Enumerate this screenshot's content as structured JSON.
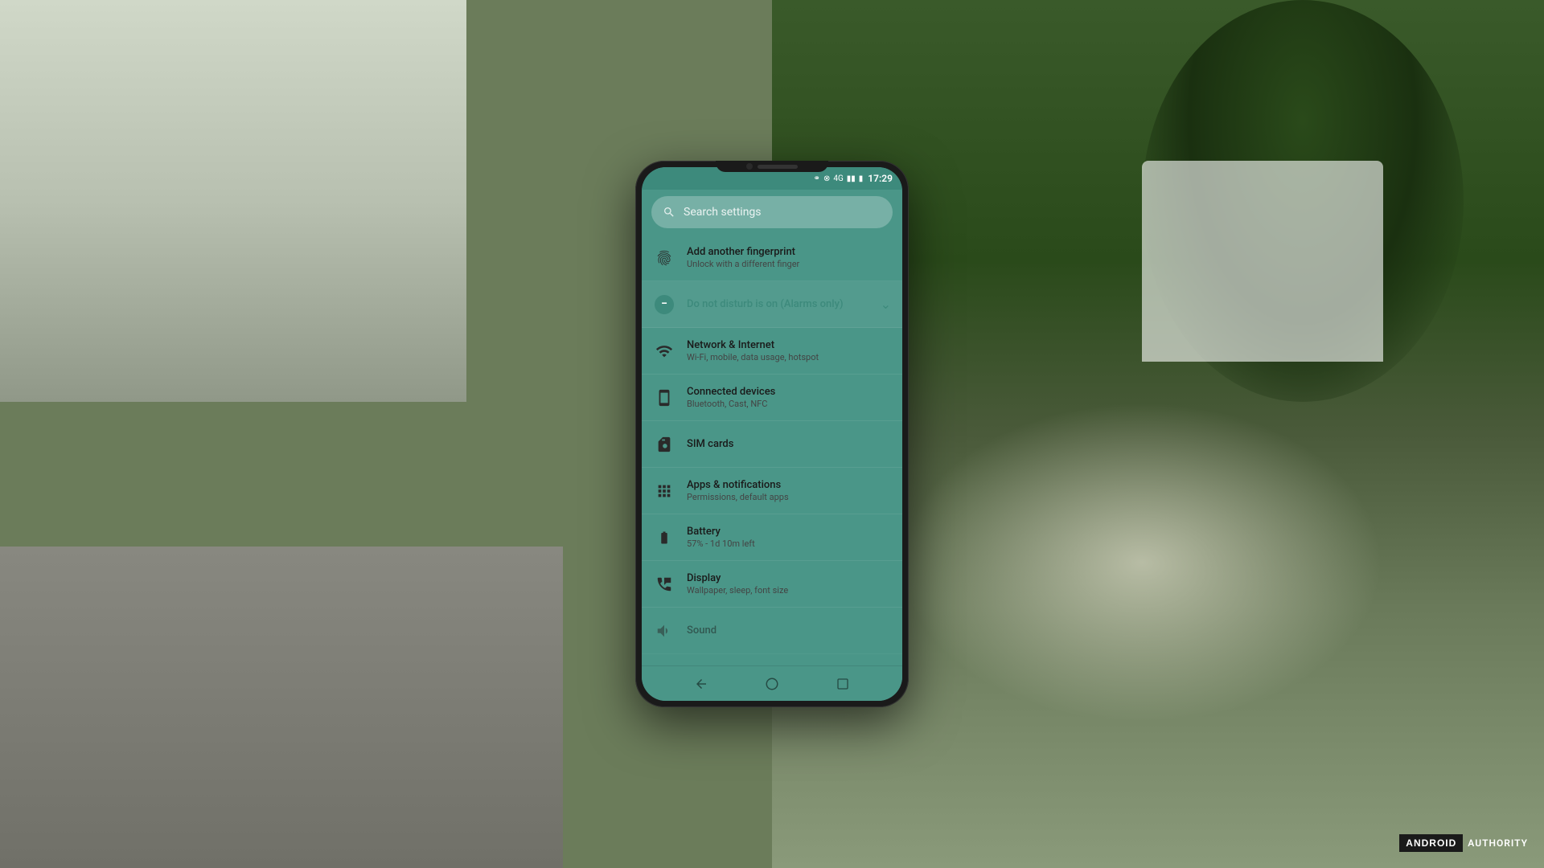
{
  "background": {
    "description": "Outdoor blurred background with hand holding phone"
  },
  "phone": {
    "status_bar": {
      "time": "17:29",
      "icons": [
        "bluetooth",
        "dnd",
        "4g",
        "signal",
        "battery"
      ]
    },
    "search": {
      "placeholder": "Search settings"
    },
    "settings_items": [
      {
        "id": "fingerprint",
        "icon": "fingerprint",
        "title": "Add another fingerprint",
        "subtitle": "Unlock with a different finger",
        "has_chevron": false,
        "is_dnd": false
      },
      {
        "id": "dnd",
        "icon": "minus",
        "title": "Do not disturb is on (Alarms only)",
        "subtitle": "",
        "has_chevron": true,
        "is_dnd": true
      },
      {
        "id": "network",
        "icon": "wifi",
        "title": "Network & Internet",
        "subtitle": "Wi-Fi, mobile, data usage, hotspot",
        "has_chevron": false,
        "is_dnd": false
      },
      {
        "id": "connected",
        "icon": "devices",
        "title": "Connected devices",
        "subtitle": "Bluetooth, Cast, NFC",
        "has_chevron": false,
        "is_dnd": false
      },
      {
        "id": "sim",
        "icon": "sim",
        "title": "SIM cards",
        "subtitle": "",
        "has_chevron": false,
        "is_dnd": false
      },
      {
        "id": "apps",
        "icon": "apps",
        "title": "Apps & notifications",
        "subtitle": "Permissions, default apps",
        "has_chevron": false,
        "is_dnd": false
      },
      {
        "id": "battery",
        "icon": "battery",
        "title": "Battery",
        "subtitle": "57% - 1d 10m left",
        "has_chevron": false,
        "is_dnd": false
      },
      {
        "id": "display",
        "icon": "display",
        "title": "Display",
        "subtitle": "Wallpaper, sleep, font size",
        "has_chevron": false,
        "is_dnd": false
      },
      {
        "id": "sound",
        "icon": "sound",
        "title": "Sound",
        "subtitle": "",
        "has_chevron": false,
        "is_dnd": false
      }
    ],
    "nav_bar": {
      "back_label": "◀",
      "home_label": "○",
      "recents_label": "▢"
    }
  },
  "watermark": {
    "brand": "ANDROID",
    "suffix": "AUTHORITY"
  }
}
